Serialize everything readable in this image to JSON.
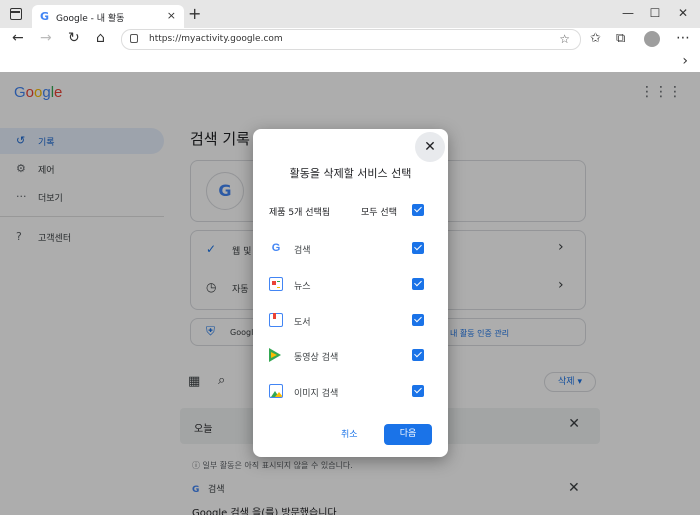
{
  "browser": {
    "tab_title": "Google - 내 활동",
    "url": "https://myactivity.google.com",
    "new_tab_glyph": "+",
    "tab_close_glyph": "×",
    "window_min_glyph": "—",
    "window_max_glyph": "☐",
    "window_close_glyph": "✕"
  },
  "page": {
    "logo_letters": [
      {
        "ch": "G",
        "color": "#4285f4"
      },
      {
        "ch": "o",
        "color": "#ea4335"
      },
      {
        "ch": "o",
        "color": "#fbbc04"
      },
      {
        "ch": "g",
        "color": "#4285f4"
      },
      {
        "ch": "l",
        "color": "#34a853"
      },
      {
        "ch": "e",
        "color": "#ea4335"
      }
    ],
    "sidebar": [
      {
        "label": "기록",
        "icon": "history-icon",
        "active": true
      },
      {
        "label": "제어",
        "icon": "settings-icon",
        "active": false
      },
      {
        "label": "더보기",
        "icon": "more-icon",
        "active": false
      },
      {
        "label": "고객센터",
        "icon": "help-icon",
        "active": false
      }
    ],
    "main_title": "검색 기록",
    "card_row_1": "웹 및",
    "card_row_2": "자동",
    "info_row_left": "Google",
    "info_row_right": "내 활동 인증 관리",
    "delete_label": "삭제",
    "today_label": "오늘",
    "note": "일부 활동은 아직 표시되지 않을 수 있습니다.",
    "search_entry": "검색",
    "cut_line": "Google 검색 을(를) 방문했습니다"
  },
  "dialog": {
    "title": "활동을 삭제할 서비스 선택",
    "summary": "제품 5개 선택됨",
    "select_all": "모두 선택",
    "services": [
      {
        "label": "검색",
        "icon": "google-g-icon"
      },
      {
        "label": "뉴스",
        "icon": "news-icon"
      },
      {
        "label": "도서",
        "icon": "books-icon"
      },
      {
        "label": "동영상 검색",
        "icon": "video-play-icon"
      },
      {
        "label": "이미지 검색",
        "icon": "image-icon"
      }
    ],
    "cancel": "취소",
    "next": "다음"
  },
  "colors": {
    "accent": "#1a73e8",
    "scrim": "rgba(0,0,0,0.32)"
  }
}
